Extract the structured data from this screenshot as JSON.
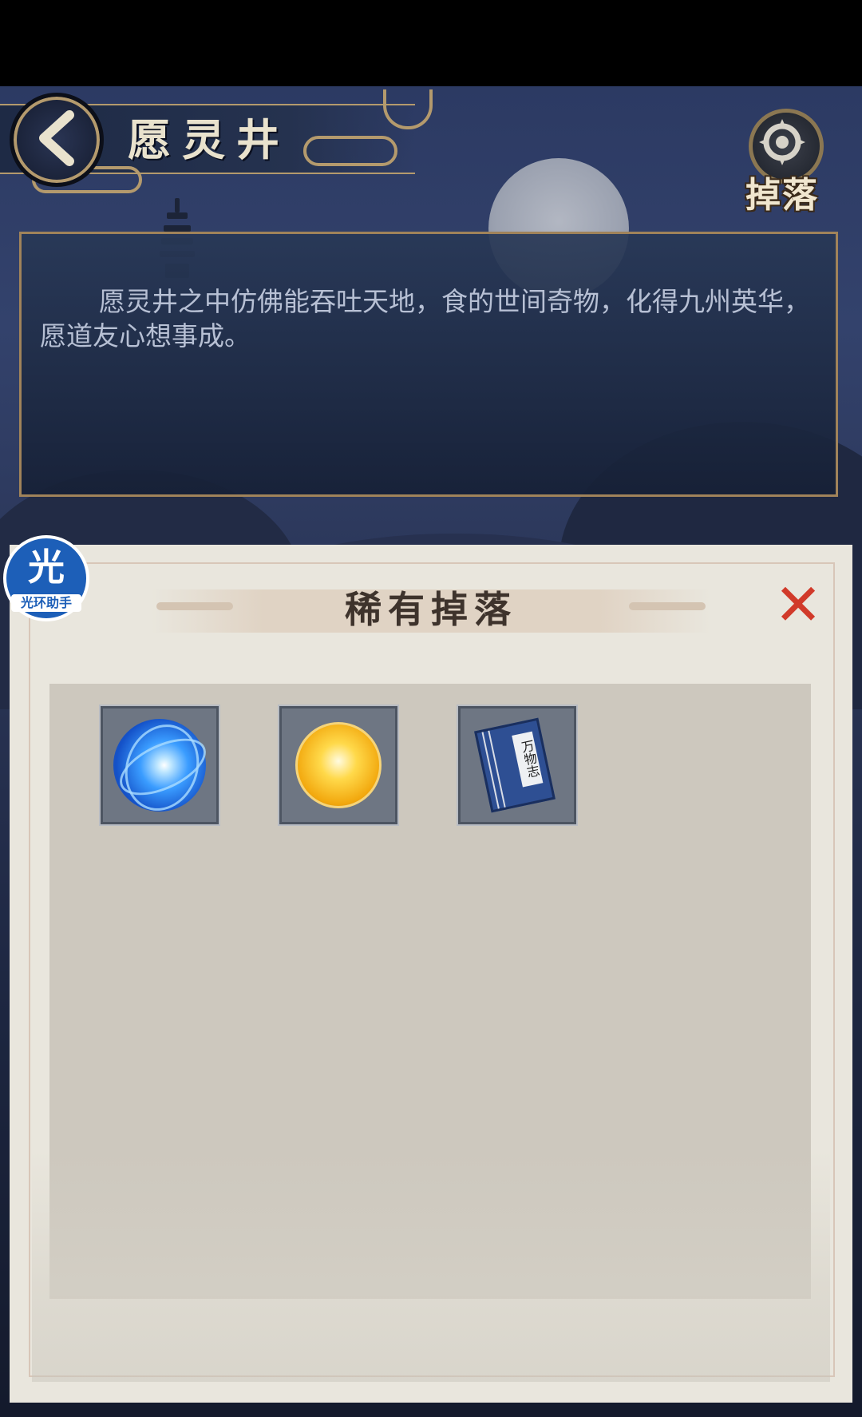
{
  "header": {
    "title": "愿灵井",
    "back_icon": "back-arrow-icon",
    "drop_button_label": "掉落",
    "drop_icon": "emblem-icon"
  },
  "description": {
    "text": "愿灵井之中仿佛能吞吐天地，食的世间奇物，化得九州英华，愿道友心想事成。"
  },
  "modal": {
    "title": "稀有掉落",
    "close_icon": "close-icon",
    "items": [
      {
        "name": "blue-energy-orb",
        "icon": "blue-orb-icon"
      },
      {
        "name": "golden-orb",
        "icon": "gold-orb-icon"
      },
      {
        "name": "book",
        "icon": "book-icon",
        "label": "万物志"
      }
    ]
  },
  "watermark": {
    "main": "光",
    "sub": "光环助手"
  },
  "colors": {
    "accent_gold": "#b49a6d",
    "close_red": "#d13a2a",
    "modal_bg": "#e9e6dd",
    "items_bg": "#cdc8be",
    "badge_blue": "#1d5fb8"
  }
}
